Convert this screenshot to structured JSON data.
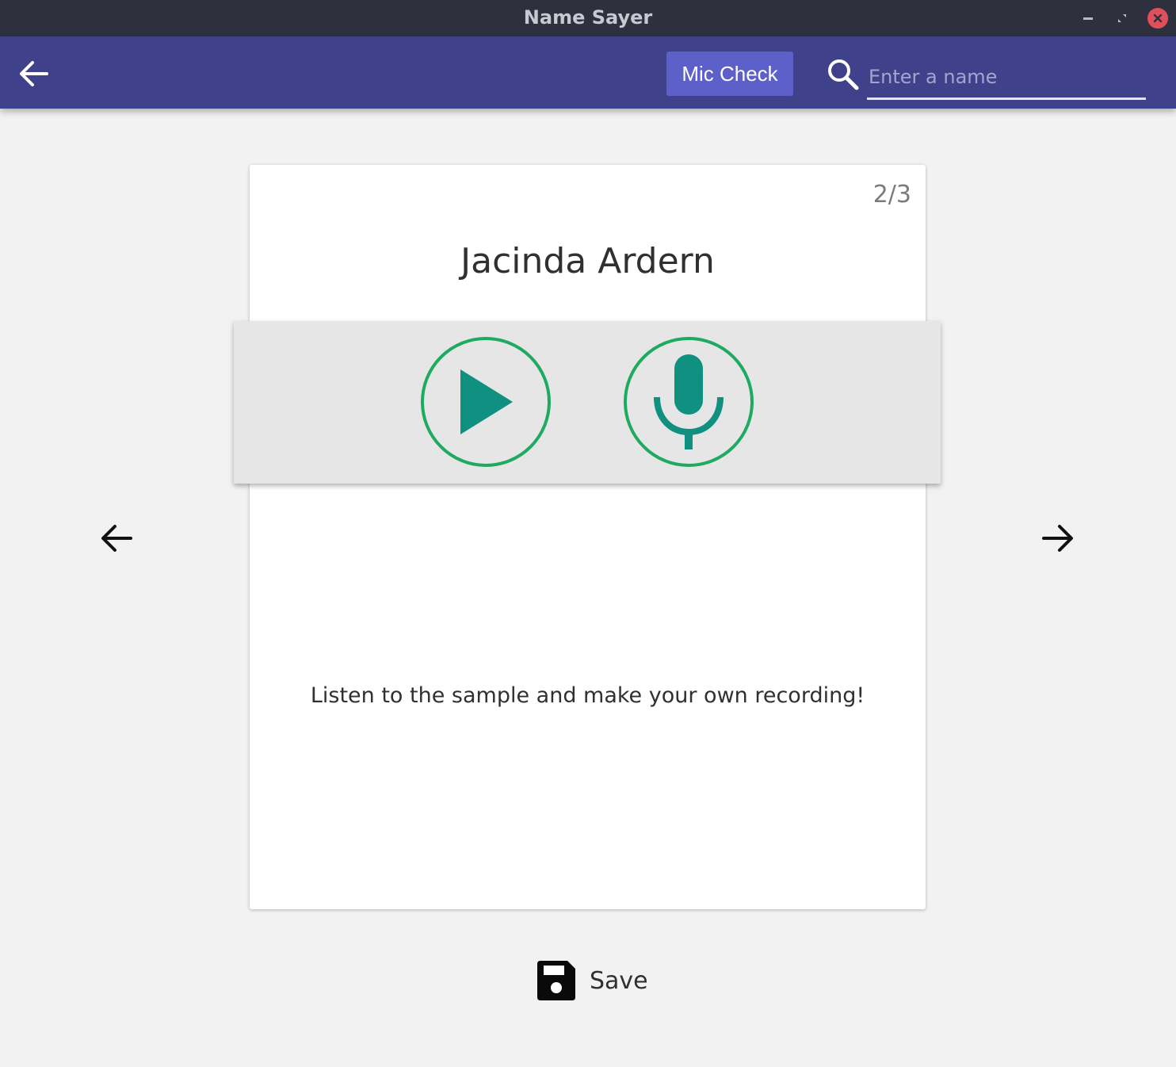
{
  "window": {
    "title": "Name Sayer"
  },
  "appbar": {
    "mic_check_label": "Mic Check",
    "search_placeholder": "Enter a name",
    "search_value": ""
  },
  "card": {
    "counter": "2/3",
    "name": "Jacinda Ardern",
    "instruction": "Listen to the sample and make your own recording!"
  },
  "footer": {
    "save_label": "Save"
  },
  "icons": {
    "back": "arrow-left-icon",
    "search": "search-icon",
    "play": "play-icon",
    "record": "microphone-icon",
    "prev": "arrow-left-icon",
    "next": "arrow-right-icon",
    "save": "floppy-disk-icon"
  },
  "colors": {
    "titlebar": "#2e303e",
    "appbar": "#3f418b",
    "button": "#5d60c9",
    "accent_teal": "#0f9080",
    "ring_green": "#1faa62",
    "close": "#e0505a"
  }
}
